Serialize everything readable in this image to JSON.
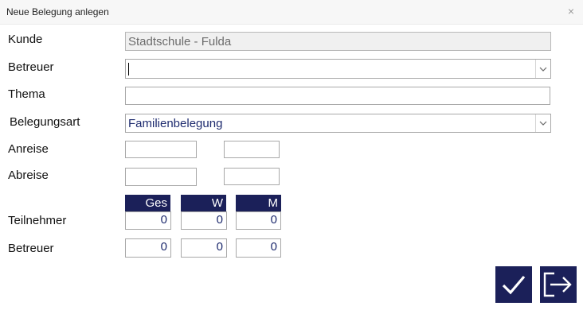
{
  "window": {
    "title": "Neue Belegung anlegen",
    "close_icon": "×"
  },
  "form": {
    "kunde_label": "Kunde",
    "kunde_value": "Stadtschule - Fulda",
    "betreuer_label": "Betreuer",
    "betreuer_value": "",
    "thema_label": "Thema",
    "thema_value": "",
    "belegungsart_label": "Belegungsart",
    "belegungsart_value": "Familienbelegung",
    "anreise_label": "Anreise",
    "anreise_date": "",
    "anreise_time": "",
    "abreise_label": "Abreise",
    "abreise_date": "",
    "abreise_time": ""
  },
  "participants": {
    "headers": [
      "Ges",
      "W",
      "M"
    ],
    "teilnehmer_label": "Teilnehmer",
    "teilnehmer_values": [
      "0",
      "0",
      "0"
    ],
    "betreuer_label": "Betreuer",
    "betreuer_values": [
      "0",
      "0",
      "0"
    ]
  },
  "actions": {
    "confirm_icon": "check-icon",
    "exit_icon": "exit-icon"
  },
  "colors": {
    "accent": "#1b2059",
    "text_value": "#1d2a6e"
  }
}
